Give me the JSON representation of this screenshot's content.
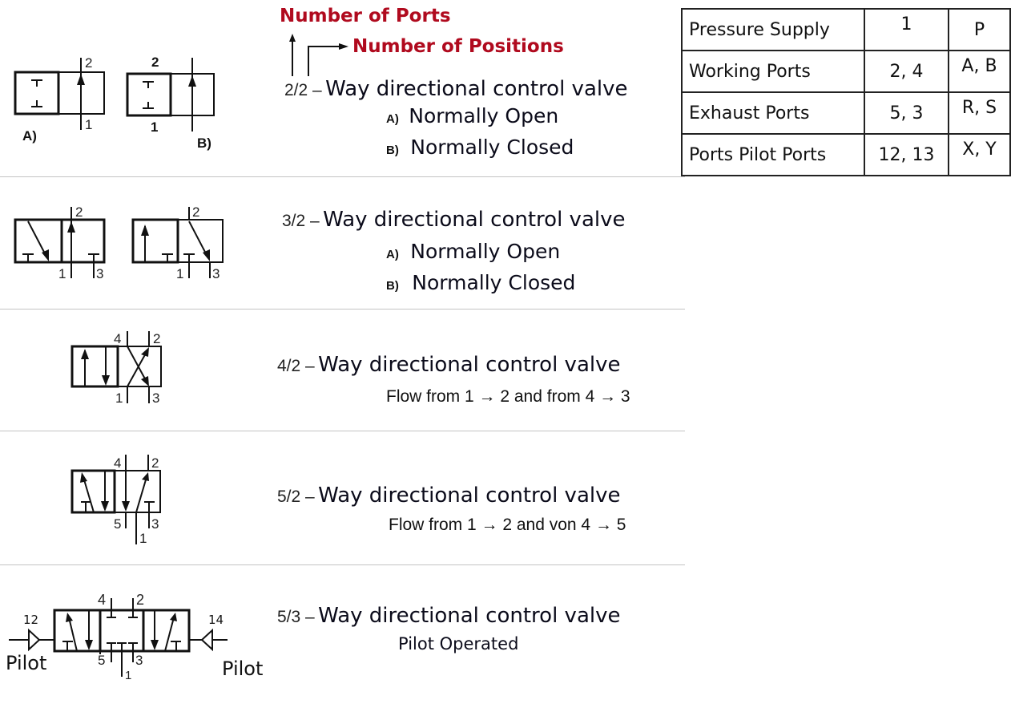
{
  "header": {
    "number_of_ports": "Number of Ports",
    "number_of_positions": "Number of Positions",
    "accent_color": "#b00a1e"
  },
  "port_table": {
    "rows": [
      {
        "name": "Pressure Supply",
        "iso": "1",
        "letter": "P"
      },
      {
        "name": "Working Ports",
        "iso": "2, 4",
        "letter": "A, B"
      },
      {
        "name": "Exhaust Ports",
        "iso": "5, 3",
        "letter": "R, S"
      },
      {
        "name": "Ports Pilot Ports",
        "iso": "12, 13",
        "letter": "X, Y"
      }
    ]
  },
  "valves": [
    {
      "code": "2/2 –",
      "title": "Way directional control valve",
      "lines": [
        {
          "marker": "A)",
          "text": "Normally Open"
        },
        {
          "marker": "B)",
          "text": "Normally Closed"
        }
      ],
      "symbol": {
        "labels": {
          "a_top": "2",
          "a_bottom": "1",
          "a_tag": "A)",
          "b_top": "2",
          "b_bottom": "1",
          "b_tag": "B)"
        }
      }
    },
    {
      "code": "3/2 –",
      "title": "Way directional control valve",
      "lines": [
        {
          "marker": "A)",
          "text": "Normally Open"
        },
        {
          "marker": "B)",
          "text": "Normally Closed"
        }
      ],
      "symbol": {
        "labels": {
          "a_p2": "2",
          "a_p1": "1",
          "a_p3": "3",
          "b_p2": "2",
          "b_p1": "1",
          "b_p3": "3"
        }
      }
    },
    {
      "code": "4/2 –",
      "title": "Way directional control valve",
      "flow": "Flow from 1 → 2 and from 4 → 3",
      "symbol": {
        "labels": {
          "p4": "4",
          "p2": "2",
          "p1": "1",
          "p3": "3"
        }
      }
    },
    {
      "code": "5/2 –",
      "title": "Way directional control valve",
      "flow": "Flow from 1 → 2 and von 4 → 5",
      "symbol": {
        "labels": {
          "p4": "4",
          "p2": "2",
          "p5": "5",
          "p3": "3",
          "p1": "1"
        }
      }
    },
    {
      "code": "5/3 –",
      "title": "Way directional control valve",
      "flow": "Pilot Operated",
      "symbol": {
        "labels": {
          "p4": "4",
          "p2": "2",
          "p5": "5",
          "p3": "3",
          "p1": "1",
          "pilot_left_num": "12",
          "pilot_right_num": "14",
          "pilot_left": "Pilot",
          "pilot_right": "Pilot"
        }
      }
    }
  ]
}
